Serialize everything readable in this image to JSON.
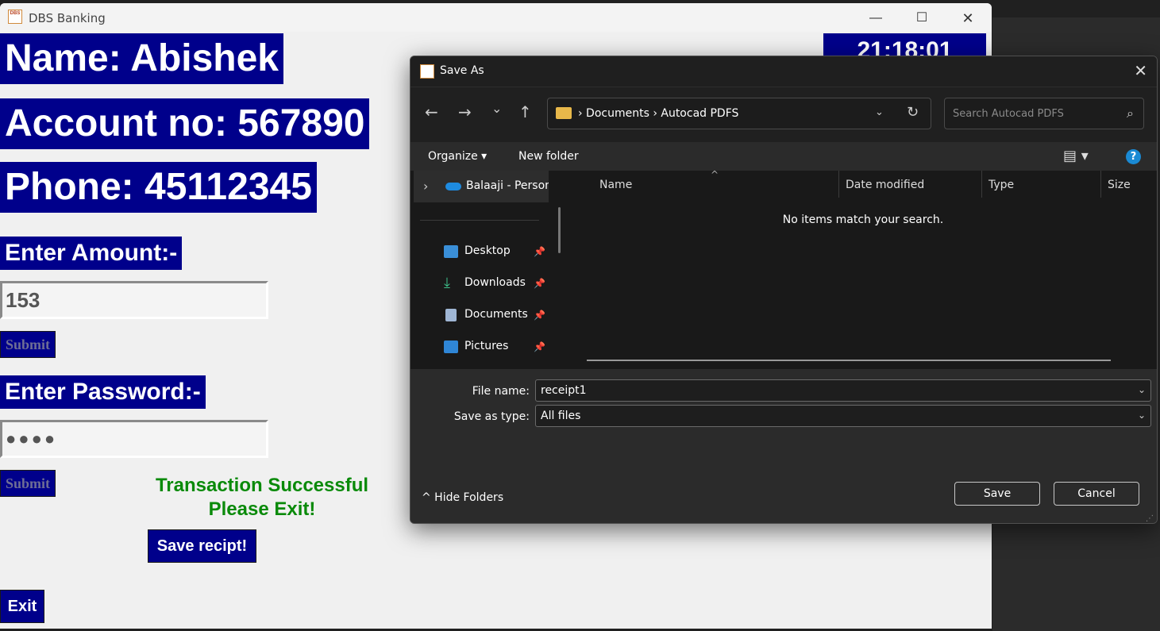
{
  "app": {
    "title": "DBS Banking",
    "icon_text": "DBS",
    "clock": "21:18:01",
    "name_label": "Name: Abishek",
    "account_label": "Account no: 567890",
    "phone_label": "Phone: 45112345",
    "amount_label": "Enter Amount:-",
    "amount_value": "153",
    "submit_label": "Submit",
    "password_label": "Enter Password:-",
    "password_masked": "●●●●",
    "submit2_label": "Submit",
    "success_line1": "Transaction Successful",
    "success_line2": "Please Exit!",
    "save_receipt_label": "Save recipt!",
    "exit_label": "Exit",
    "controls": {
      "minimize": "—",
      "maximize": "☐",
      "close": "✕"
    }
  },
  "dialog": {
    "title": "Save As",
    "close": "✕",
    "nav": {
      "back": "←",
      "forward": "→",
      "recent": "⌄",
      "up": "↑"
    },
    "breadcrumb": "›  Documents  ›  Autocad PDFS",
    "address_dropdown": "⌄",
    "refresh": "↻",
    "search_placeholder": "Search Autocad PDFS",
    "search_icon": "⌕",
    "toolbar": {
      "organize": "Organize ▾",
      "new_folder": "New folder",
      "view": "▤ ▾",
      "help": "?"
    },
    "nav_pane": {
      "onedrive_expand": "›",
      "onedrive": "Balaaji - Persona",
      "items": [
        {
          "label": "Desktop",
          "pin": "📌"
        },
        {
          "label": "Downloads",
          "pin": "📌"
        },
        {
          "label": "Documents",
          "pin": "📌"
        },
        {
          "label": "Pictures",
          "pin": "📌"
        }
      ]
    },
    "columns": {
      "name": "Name",
      "date": "Date modified",
      "type": "Type",
      "size": "Size",
      "sort": "^"
    },
    "empty_message": "No items match your search.",
    "file_name_label": "File name:",
    "file_name_value": "receipt1",
    "save_type_label": "Save as type:",
    "save_type_value": "All files",
    "dropdown_glyph": "⌄",
    "hide_folders": "^  Hide Folders",
    "save_button": "Save",
    "cancel_button": "Cancel"
  }
}
